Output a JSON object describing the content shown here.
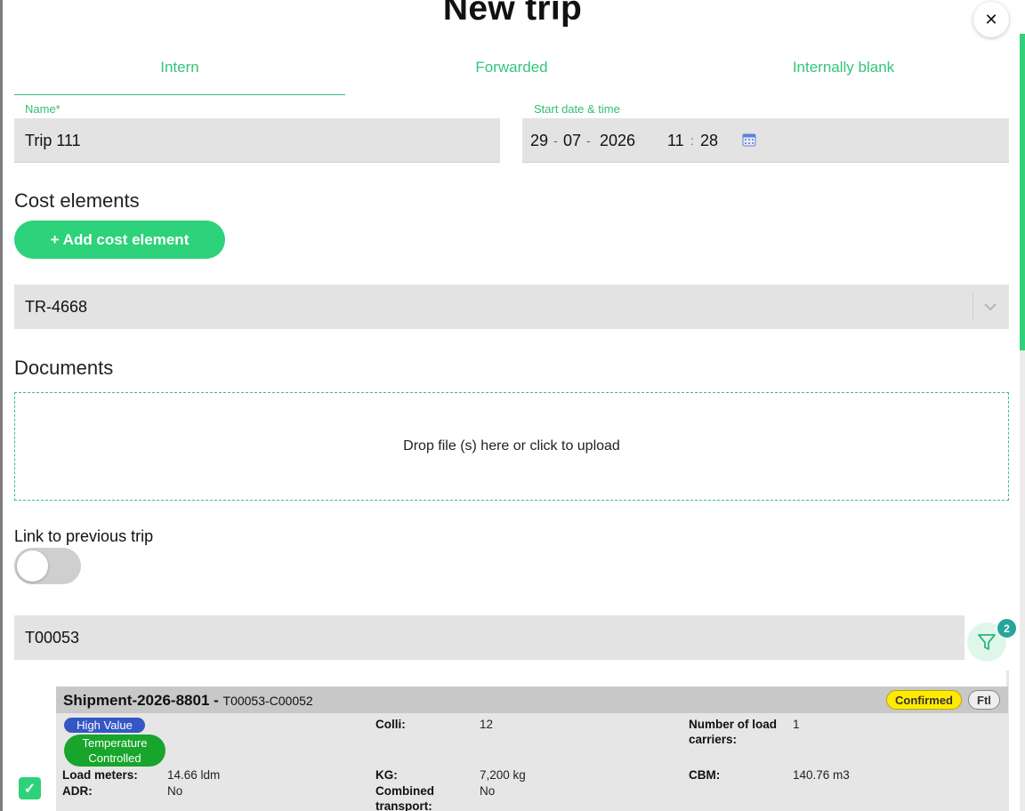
{
  "title": "New trip",
  "tabs": [
    {
      "label": "Intern"
    },
    {
      "label": "Forwarded"
    },
    {
      "label": "Internally blank"
    }
  ],
  "name_field": {
    "label": "Name*",
    "value": "Trip 111"
  },
  "start_field": {
    "label": "Start date & time",
    "day": "29",
    "month": "07",
    "year": "2026",
    "hour": "11",
    "minute": "28",
    "date_sep": "-",
    "time_sep": ":"
  },
  "cost": {
    "title": "Cost elements",
    "add_button": "+ Add cost element",
    "selected": "TR-4668"
  },
  "documents": {
    "title": "Documents",
    "dropzone": "Drop file (s) here or click to upload"
  },
  "link_previous": {
    "label": "Link to previous trip",
    "enabled": false
  },
  "search": {
    "value": "T00053"
  },
  "filter": {
    "count": "2"
  },
  "shipment": {
    "title": "Shipment-2026-8801",
    "dash": " - ",
    "code": "T00053-C00052",
    "status": "Confirmed",
    "mode": "Ftl",
    "tags": [
      "High Value",
      "Temperature Controlled"
    ],
    "colli_label": "Colli:",
    "colli_value": "12",
    "carriers_label": "Number of load carriers:",
    "carriers_value": "1",
    "load_meters_label": "Load meters:",
    "load_meters_value": "14.66 ldm",
    "kg_label": "KG:",
    "kg_value": "7,200 kg",
    "cbm_label": "CBM:",
    "cbm_value": "140.76 m3",
    "adr_label": "ADR:",
    "adr_value": "No",
    "combined_label": "Combined transport:",
    "combined_value": "No",
    "checked": true
  },
  "colors": {
    "accent": "#2dd27a",
    "badge_teal": "#26a69a",
    "status_yellow": "#ffeb00",
    "tag_blue": "#3457c4",
    "tag_green": "#17a52c"
  }
}
